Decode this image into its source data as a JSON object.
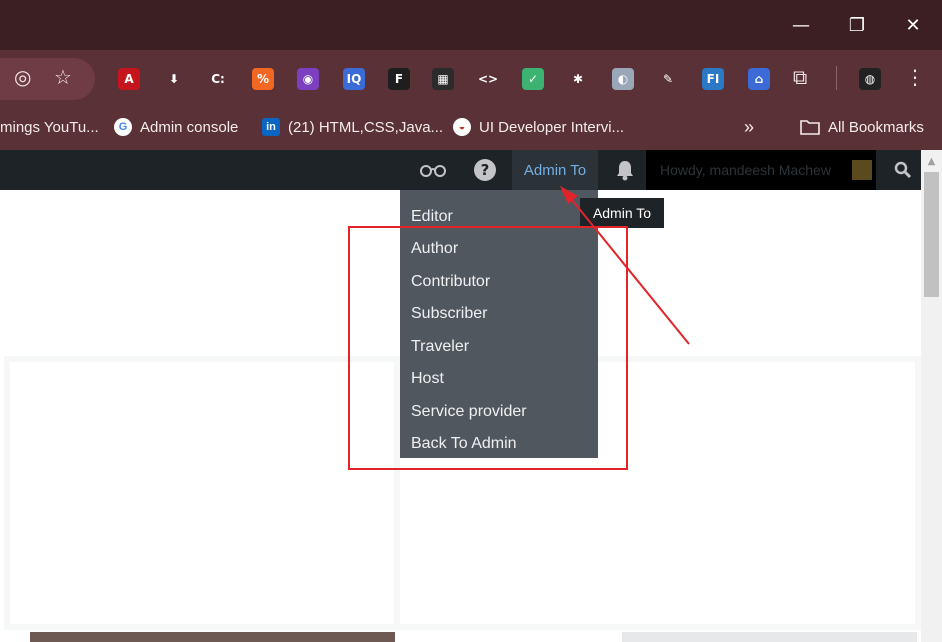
{
  "window": {
    "minimize": "—",
    "maximize": "❐",
    "close": "✕"
  },
  "toolbar": {
    "icons": [
      {
        "name": "hide-eye-icon",
        "glyph": "◎"
      },
      {
        "name": "star-bookmark-icon",
        "glyph": "☆"
      },
      {
        "name": "acrobat-ext-icon",
        "glyph": "A",
        "color": "#c4161c"
      },
      {
        "name": "download-ext-icon",
        "glyph": "⬇",
        "color": "#5a3136"
      },
      {
        "name": "cc-ext-icon",
        "glyph": "C:",
        "color": "#5a3136"
      },
      {
        "name": "percent-ext-icon",
        "glyph": "%",
        "color": "#f26722"
      },
      {
        "name": "color-ring-ext-icon",
        "glyph": "◉",
        "color": "#7b3fbf"
      },
      {
        "name": "iq-ext-icon",
        "glyph": "IQ",
        "color": "#3b6bd6"
      },
      {
        "name": "figma-ext-icon",
        "glyph": "F",
        "color": "#1e1e1e"
      },
      {
        "name": "design-ext-icon",
        "glyph": "▦",
        "color": "#2b2b2b"
      },
      {
        "name": "code-ext-icon",
        "glyph": "<>",
        "color": "#5a3136"
      },
      {
        "name": "shield-ext-icon",
        "glyph": "✓",
        "color": "#3cb371"
      },
      {
        "name": "bug-ext-icon",
        "glyph": "✱",
        "color": "#5a3136"
      },
      {
        "name": "security-ext-icon",
        "glyph": "◐",
        "color": "#9aa7b8"
      },
      {
        "name": "feather-ext-icon",
        "glyph": "✎",
        "color": "#5a3136"
      },
      {
        "name": "fi-ext-icon",
        "glyph": "FI",
        "color": "#2b78c5"
      },
      {
        "name": "home-ext-icon",
        "glyph": "⌂",
        "color": "#3b6bd6"
      },
      {
        "name": "puzzle-extensions-icon",
        "glyph": "⧉",
        "color": "#5a3136"
      },
      {
        "name": "profile-avatar-icon",
        "glyph": "◍",
        "color": "#222222"
      },
      {
        "name": "kebab-menu-icon",
        "glyph": "⋮",
        "color": "#5a3136"
      }
    ]
  },
  "bookmarks": {
    "item1": "mings YouTu...",
    "item2": "Admin console",
    "item3": "(21) HTML,CSS,Java...",
    "item4": "UI Developer Intervi...",
    "overflow": "»",
    "all": "All Bookmarks"
  },
  "adminbar": {
    "admin_to": "Admin To",
    "howdy": "Howdy, mandeesh Machew"
  },
  "tooltip": "Admin To",
  "dropdown": {
    "items": [
      "Editor",
      "Author",
      "Contributor",
      "Subscriber",
      "Traveler",
      "Host",
      "Service provider",
      "Back To Admin"
    ]
  },
  "colors": {
    "annotation": "#e0242a",
    "link": "#72aee6",
    "adminbar": "#1d2327",
    "submenu": "#50575e"
  }
}
